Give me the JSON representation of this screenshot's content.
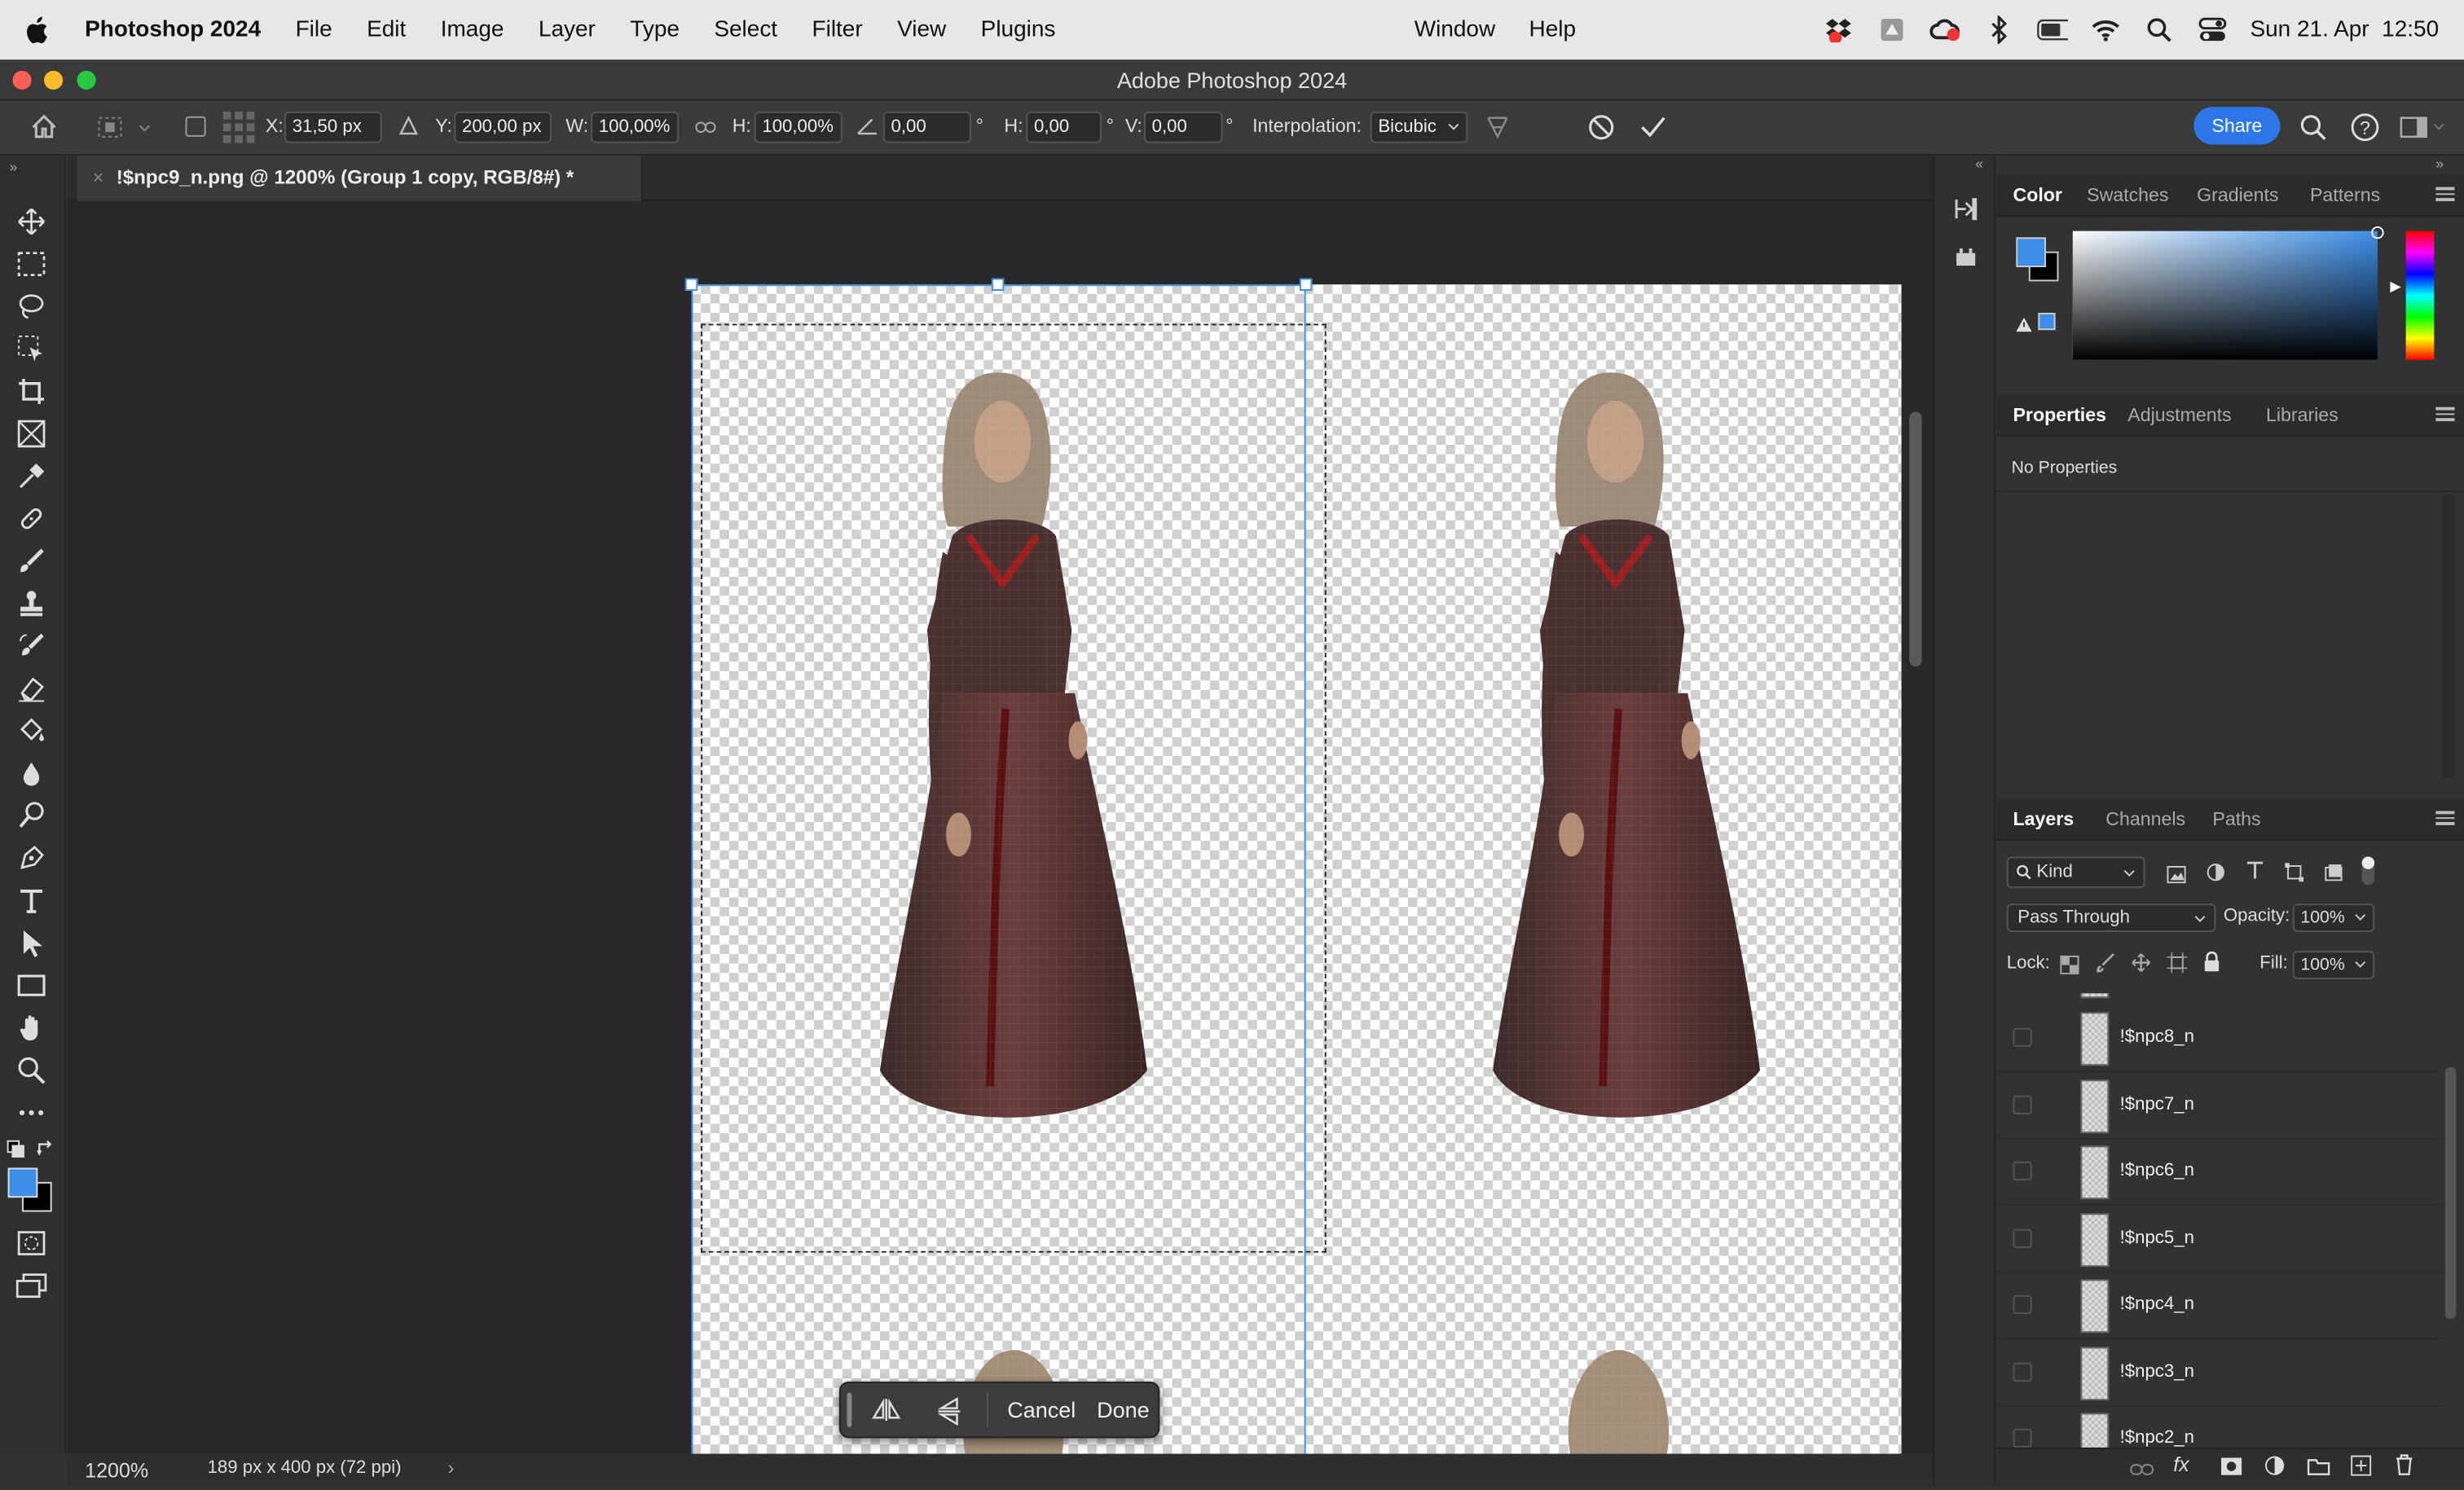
{
  "menubar": {
    "app_name": "Photoshop 2024",
    "items": [
      "File",
      "Edit",
      "Image",
      "Layer",
      "Type",
      "Select",
      "Filter",
      "View",
      "Plugins"
    ],
    "right_items": [
      "Window",
      "Help"
    ],
    "datetime": "Sun 21. Apr  12:50"
  },
  "window": {
    "title": "Adobe Photoshop 2024"
  },
  "options": {
    "x_label": "X:",
    "x_value": "31,50 px",
    "y_label": "Y:",
    "y_value": "200,00 px",
    "w_label": "W:",
    "w_value": "100,00%",
    "h_label": "H:",
    "h_value": "100,00%",
    "angle_value": "0,00",
    "deg": "°",
    "hskew_label": "H:",
    "hskew_value": "0,00",
    "vskew_label": "V:",
    "vskew_value": "0,00",
    "interp_label": "Interpolation:",
    "interp_value": "Bicubic",
    "share_label": "Share"
  },
  "document": {
    "tab_title": "!$npc9_n.png @ 1200% (Group 1 copy, RGB/8#) *",
    "zoom": "1200%",
    "doc_info": "189 px x 400 px (72 ppi)"
  },
  "context_bar": {
    "cancel": "Cancel",
    "done": "Done"
  },
  "panels": {
    "color_tabs": [
      "Color",
      "Swatches",
      "Gradients",
      "Patterns"
    ],
    "props_tabs": [
      "Properties",
      "Adjustments",
      "Libraries"
    ],
    "no_properties": "No Properties",
    "layers_tabs": [
      "Layers",
      "Channels",
      "Paths"
    ],
    "filter_kind": "Kind",
    "blend_mode": "Pass Through",
    "opacity_label": "Opacity:",
    "opacity_value": "100%",
    "lock_label": "Lock:",
    "fill_label": "Fill:",
    "fill_value": "100%",
    "layers": [
      "!$npc8_n",
      "!$npc7_n",
      "!$npc6_n",
      "!$npc5_n",
      "!$npc4_n",
      "!$npc3_n",
      "!$npc2_n"
    ]
  },
  "colors": {
    "foreground": "#3d8ee8",
    "background": "#000000",
    "accent": "#2d77e8",
    "selection": "#3d8ee8"
  }
}
